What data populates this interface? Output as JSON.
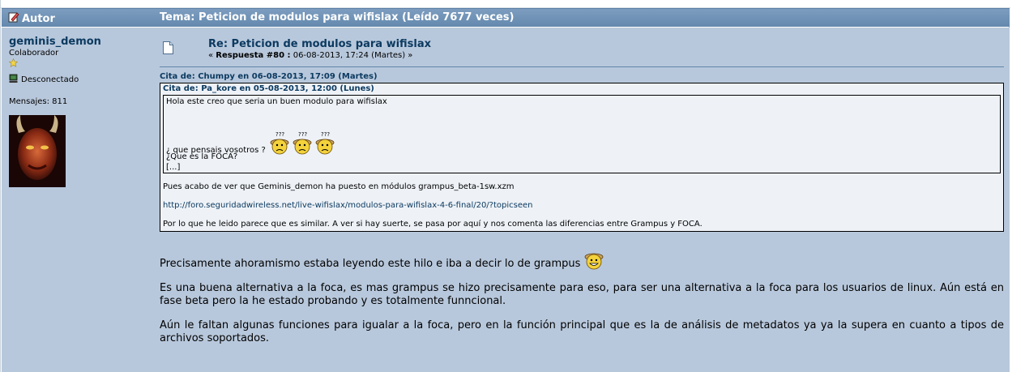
{
  "header": {
    "autor_label": "Autor",
    "topic_title": "Tema: Peticion de modulos para wifislax  (Leído 7677 veces)"
  },
  "author": {
    "username": "geminis_demon",
    "rank": "Colaborador",
    "status": "Desconectado",
    "posts": "Mensajes: 811"
  },
  "post": {
    "subject": "Re: Peticion de modulos para wifislax",
    "reply_prefix": "« ",
    "reply_label": "Respuesta #80 :",
    "reply_date": " 06-08-2013, 17:24 (Martes) »"
  },
  "quote_outer": {
    "header": "Cita de: Chumpy en 06-08-2013, 17:09 (Martes)",
    "para1": "Pues acabo de ver que Geminis_demon ha puesto en módulos grampus_beta-1sw.xzm",
    "link": "http://foro.seguridadwireless.net/live-wifislax/modulos-para-wifislax-4-6-final/20/?topicseen",
    "para3": "Por lo que he leido parece que es similar. A ver si hay suerte, se pasa por aquí y nos comenta las diferencias entre Grampus y FOCA."
  },
  "quote_inner": {
    "header": "Cita de: Pa_kore en 05-08-2013, 12:00 (Lunes)",
    "line1": "Hola  este creo que seria un buen  modulo para wifislax",
    "line2": "¿ que pensais  vosotros ?",
    "line3": "¿Que es la FOCA?",
    "line4": "[...]"
  },
  "body": {
    "p1": "Precisamente ahoramismo estaba leyendo este hilo e iba a decir lo de grampus",
    "p2": "Es una buena alternativa a la foca, es mas grampus se hizo precisamente para eso, para ser una alternativa a la foca para los usuarios de linux. Aún está en fase beta pero la he estado probando y es totalmente funncional.",
    "p3": "Aún le faltan algunas funciones para igualar a la foca, pero en la función principal que es la de análisis de metadatos ya ya la supera en cuanto a tipos de archivos soportados."
  },
  "colors": {
    "header_bg": "#6f93b7",
    "post_bg": "#b8c8dc",
    "link": "#0c3a60"
  },
  "icons": [
    "pencil-icon",
    "rank-star-icon",
    "offline-icon",
    "document-icon",
    "confused-smiley-icon",
    "grin-smiley-icon"
  ]
}
